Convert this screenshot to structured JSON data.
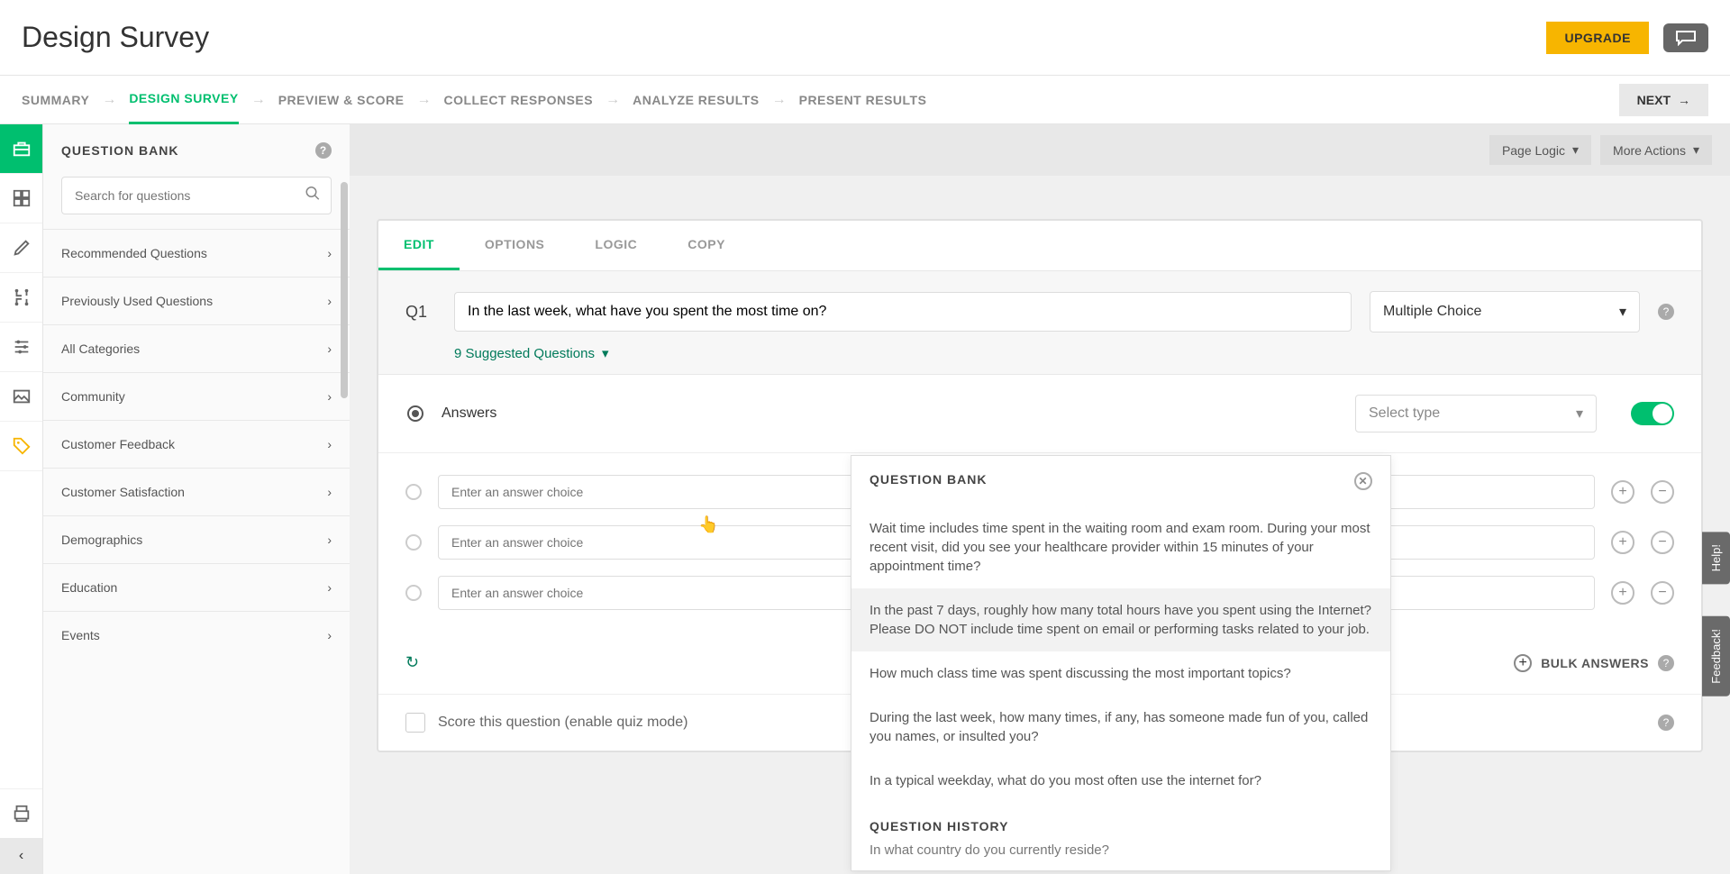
{
  "header": {
    "title": "Design Survey",
    "upgrade_label": "UPGRADE"
  },
  "subnav": {
    "items": [
      "SUMMARY",
      "DESIGN SURVEY",
      "PREVIEW & SCORE",
      "COLLECT RESPONSES",
      "ANALYZE RESULTS",
      "PRESENT RESULTS"
    ],
    "active_index": 1,
    "next_label": "NEXT"
  },
  "sidebar": {
    "title": "QUESTION BANK",
    "search_placeholder": "Search for questions",
    "items": [
      {
        "label": "Recommended Questions"
      },
      {
        "label": "Previously Used Questions"
      },
      {
        "label": "All Categories"
      },
      {
        "label": "Community"
      },
      {
        "label": "Customer Feedback"
      },
      {
        "label": "Customer Satisfaction"
      },
      {
        "label": "Demographics"
      },
      {
        "label": "Education"
      },
      {
        "label": "Events"
      }
    ]
  },
  "main": {
    "topbar": {
      "page_logic": "Page Logic",
      "more_actions": "More Actions"
    },
    "card": {
      "tabs": [
        "EDIT",
        "OPTIONS",
        "LOGIC",
        "COPY"
      ],
      "active_tab": 0,
      "q_id": "Q1",
      "q_text": "In the last week, what have you spent the most time on?",
      "q_type": "Multiple Choice",
      "suggested_label": "9 Suggested Questions",
      "answers_label": "Answers",
      "select_type_label": "Select type",
      "answer_placeholder": "Enter an answer choice",
      "bulk_label": "BULK ANSWERS",
      "score_label": "Score this question (enable quiz mode)"
    }
  },
  "popover": {
    "title": "QUESTION BANK",
    "items": [
      "Wait time includes time spent in the waiting room and exam room. During your most recent visit, did you see your healthcare provider within 15 minutes of your appointment time?",
      "In the past 7 days, roughly how many total hours have you spent using the Internet? Please DO NOT include time spent on email or performing tasks related to your job.",
      "How much class time was spent discussing the most important topics?",
      "During the last week, how many times, if any, has someone made fun of you, called you names, or insulted you?",
      "In a typical weekday, what do you most often use the internet for?"
    ],
    "highlighted_index": 1,
    "history_title": "QUESTION HISTORY",
    "history_item": "In what country do you currently reside?"
  },
  "side_tabs": {
    "help": "Help!",
    "feedback": "Feedback!"
  }
}
